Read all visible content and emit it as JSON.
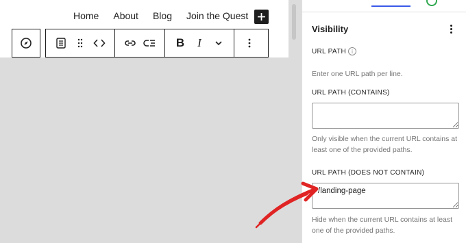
{
  "nav": {
    "items": [
      "Home",
      "About",
      "Blog",
      "Join the Quest"
    ]
  },
  "toolbar": {
    "icons": [
      "compass-icon",
      "block-icon",
      "drag-handle-icon",
      "code-icon",
      "link-icon",
      "submenu-icon",
      "bold-icon",
      "italic-icon",
      "chevron-down-icon",
      "more-options-icon"
    ],
    "bold_label": "B",
    "italic_label": "I"
  },
  "sidebar": {
    "title": "Visibility",
    "url_path": {
      "label": "URL PATH",
      "help": "Enter one URL path per line."
    },
    "contains": {
      "label": "URL PATH",
      "sub": "(CONTAINS)",
      "value": "",
      "help": "Only visible when the current URL contains at least one of the provided paths."
    },
    "not_contains": {
      "label": "URL PATH",
      "sub": "(DOES NOT CONTAIN)",
      "value": "/landing-page",
      "help": "Hide when the current URL contains at least one of the provided paths."
    }
  },
  "colors": {
    "accent": "#3858e9",
    "arrow": "#e02424",
    "status_green": "#2fa84f"
  }
}
